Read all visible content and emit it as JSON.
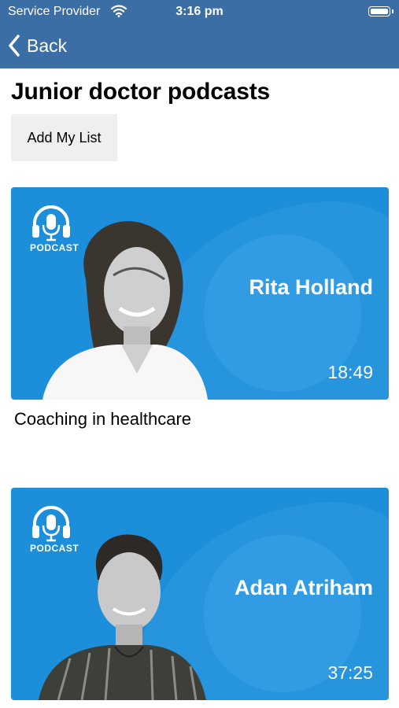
{
  "status_bar": {
    "carrier": "Service Provider",
    "time": "3:16 pm"
  },
  "nav": {
    "back_label": "Back"
  },
  "page": {
    "title": "Junior doctor podcasts",
    "add_button": "Add My List"
  },
  "episodes": [
    {
      "logo_label": "PODCAST",
      "host": "Rita Holland",
      "duration": "18:49",
      "title": "Coaching in healthcare"
    },
    {
      "logo_label": "PODCAST",
      "host": "Adan Atriham",
      "duration": "37:25"
    }
  ],
  "colors": {
    "header": "#3a6ea5",
    "card": "#1d8ed9",
    "card_accent": "#3aa3e8"
  },
  "icons": [
    "wifi-icon",
    "battery-icon",
    "chevron-left-icon",
    "podcast-headphones-icon"
  ]
}
